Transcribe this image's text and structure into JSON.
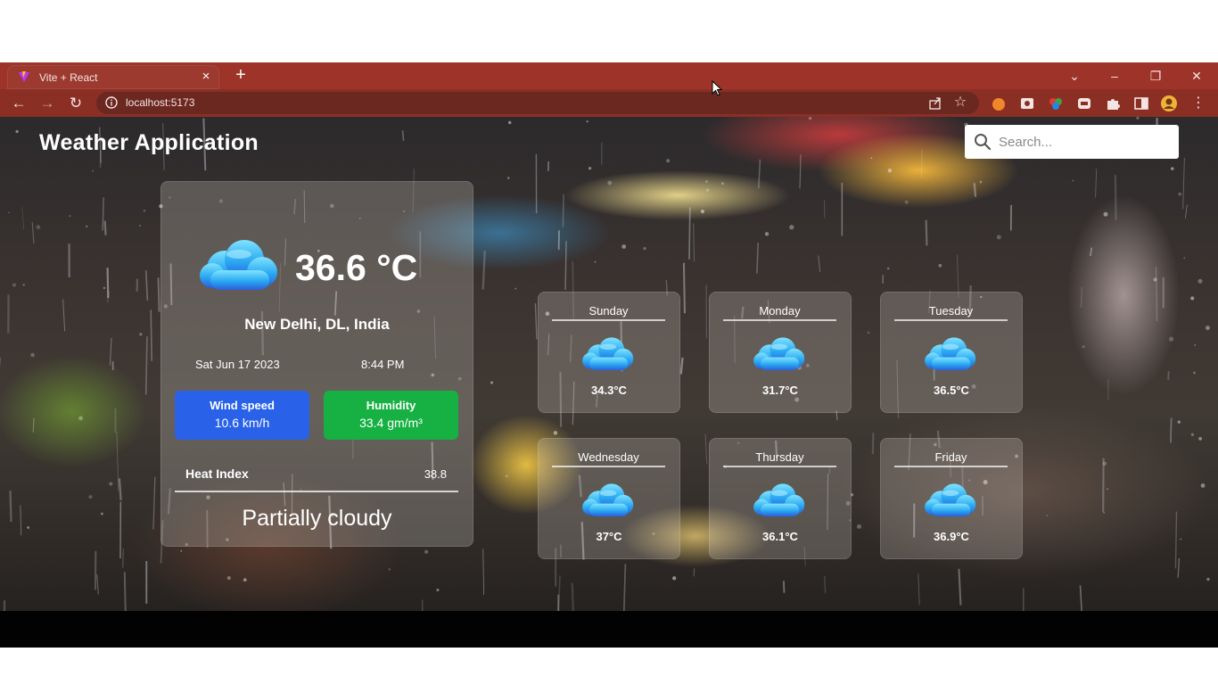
{
  "browser": {
    "tab_title": "Vite + React",
    "tab_close": "×",
    "new_tab": "+",
    "url": "localhost:5173",
    "window_controls": {
      "list": "⌄",
      "minimize": "–",
      "restore": "❐",
      "close": "✕"
    },
    "nav": {
      "back": "←",
      "forward": "→",
      "reload": "↻"
    },
    "star": "☆"
  },
  "app": {
    "title": "Weather Application",
    "search": {
      "placeholder": "Search...",
      "value": ""
    }
  },
  "current": {
    "temperature": "36.6 °C",
    "location": "New Delhi, DL, India",
    "date": "Sat Jun 17 2023",
    "time": "8:44 PM",
    "wind": {
      "label": "Wind speed",
      "value": "10.6 km/h",
      "color": "#2962e8"
    },
    "humidity": {
      "label": "Humidity",
      "value": "33.4 gm/m³",
      "color": "#17b043"
    },
    "heat_index": {
      "label": "Heat Index",
      "value": "38.8"
    },
    "condition": "Partially cloudy",
    "icon": "cloud-icon"
  },
  "forecast": [
    {
      "day": "Sunday",
      "temp": "34.3°C",
      "icon": "cloud-icon"
    },
    {
      "day": "Monday",
      "temp": "31.7°C",
      "icon": "cloud-icon"
    },
    {
      "day": "Tuesday",
      "temp": "36.5°C",
      "icon": "cloud-icon"
    },
    {
      "day": "Wednesday",
      "temp": "37°C",
      "icon": "cloud-icon"
    },
    {
      "day": "Thursday",
      "temp": "36.1°C",
      "icon": "cloud-icon"
    },
    {
      "day": "Friday",
      "temp": "36.9°C",
      "icon": "cloud-icon"
    }
  ]
}
